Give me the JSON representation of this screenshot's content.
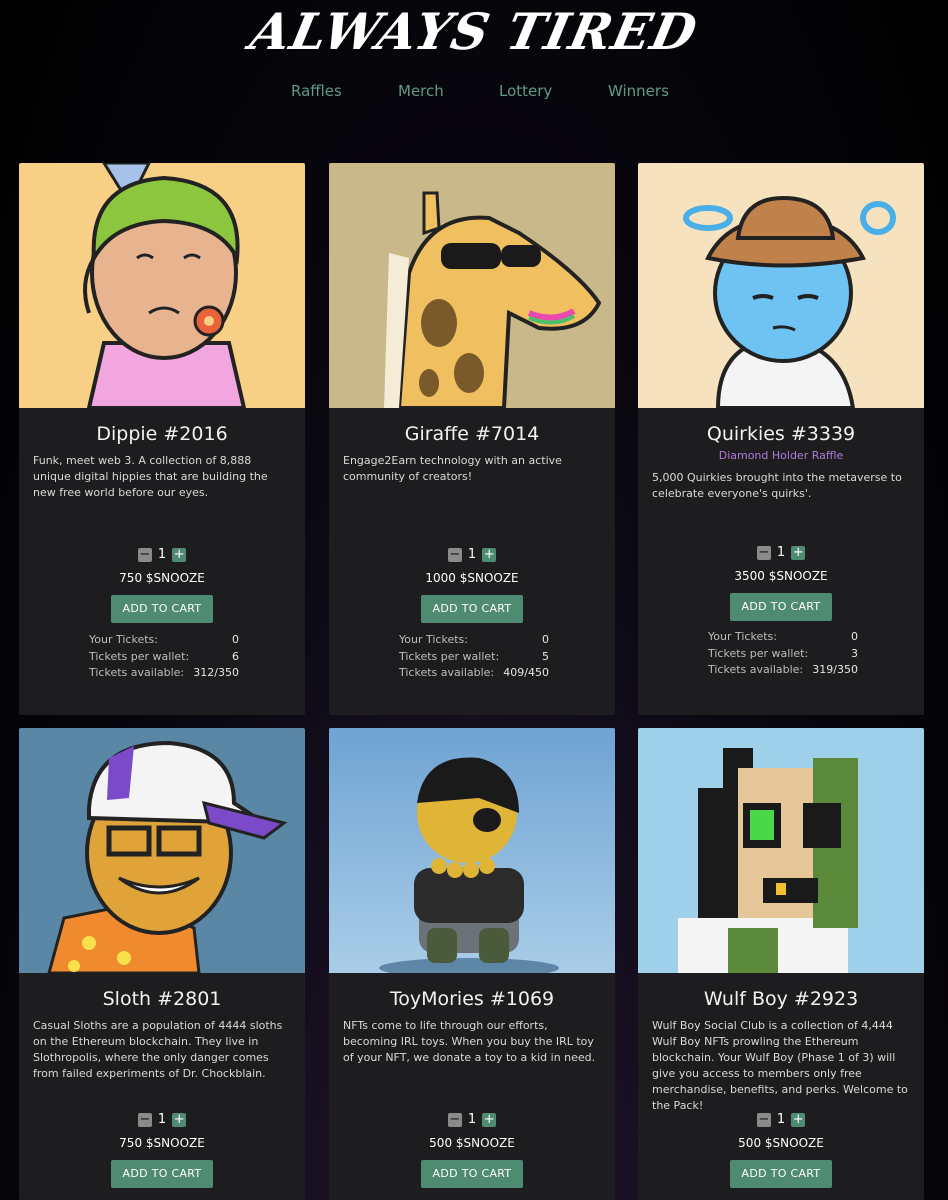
{
  "brand": {
    "logo": "ALWAYS TIRED"
  },
  "nav": [
    {
      "label": "Raffles"
    },
    {
      "label": "Merch"
    },
    {
      "label": "Lottery"
    },
    {
      "label": "Winners"
    }
  ],
  "colors": {
    "accent": "#4f8a72",
    "nav": "#5f9a85",
    "card_bg": "#1d1d1f",
    "subtitle": "#b07ad8"
  },
  "stat_labels": {
    "your_tickets": "Your Tickets:",
    "per_wallet": "Tickets per wallet:",
    "available": "Tickets available:"
  },
  "cart_label": "ADD TO CART",
  "cards": [
    {
      "title": "Dippie #2016",
      "description": "Funk, meet web 3. A collection of 8,888 unique digital hippies that are building the new free world before our eyes.",
      "quantity": "1",
      "price": "750 $SNOOZE",
      "your_tickets": "0",
      "per_wallet": "6",
      "available": "312/350",
      "image_bg": "#f7cf85"
    },
    {
      "title": "Giraffe #7014",
      "description": "Engage2Earn technology with an active community of creators!",
      "quantity": "1",
      "price": "1000 $SNOOZE",
      "your_tickets": "0",
      "per_wallet": "5",
      "available": "409/450",
      "image_bg": "#c9b98a"
    },
    {
      "title": "Quirkies #3339",
      "subtitle": "Diamond Holder Raffle",
      "description": "5,000 Quirkies brought into the metaverse to celebrate everyone's quirks'.",
      "quantity": "1",
      "price": "3500 $SNOOZE",
      "your_tickets": "0",
      "per_wallet": "3",
      "available": "319/350",
      "image_bg": "#f6e2bf"
    },
    {
      "title": "Sloth #2801",
      "description": "Casual Sloths are a population of 4444 sloths on the Ethereum blockchain. They live in Slothropolis, where the only danger comes from failed experiments of Dr. Chockblain.",
      "quantity": "1",
      "price": "750 $SNOOZE",
      "image_bg": "#5b87a6"
    },
    {
      "title": "ToyMories #1069",
      "description": "NFTs come to life through our efforts, becoming IRL toys. When you buy the IRL toy of your NFT, we donate a toy to a kid in need.",
      "quantity": "1",
      "price": "500 $SNOOZE",
      "image_bg": "#7fb0d9"
    },
    {
      "title": "Wulf Boy #2923",
      "description": "Wulf Boy Social Club is a collection of 4,444 Wulf Boy NFTs prowling the Ethereum blockchain. Your Wulf Boy (Phase 1 of 3) will give you access to members only free merchandise, benefits, and perks. Welcome to the Pack!",
      "quantity": "1",
      "price": "500 $SNOOZE",
      "image_bg": "#9fd0ea"
    }
  ]
}
